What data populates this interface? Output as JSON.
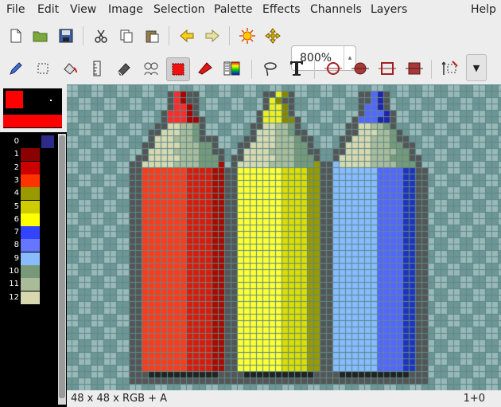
{
  "menus": [
    "File",
    "Edit",
    "View",
    "Image",
    "Selection",
    "Palette",
    "Effects",
    "Channels",
    "Layers",
    "Help"
  ],
  "toolbar1": [
    "new-icon",
    "open-icon",
    "save-icon",
    "cut-icon",
    "copy-icon",
    "paste-icon",
    "arrow-left-icon",
    "arrow-right-icon",
    "brightness-icon",
    "move-icon"
  ],
  "toolbar2": [
    "pencil-icon",
    "select-icon",
    "fill-icon",
    "ruler-icon",
    "eraser-icon",
    "clone-icon",
    "rect-tool-icon",
    "color-pick-icon",
    "gradient-icon",
    "lasso-icon",
    "text-icon",
    "circle-tool-icon",
    "ellipse-tool-icon",
    "square-tool-icon",
    "filled-square-icon",
    "flip-icon"
  ],
  "zoom": {
    "value": "800%"
  },
  "palette": {
    "entries": [
      {
        "index": "0",
        "color": "#000000",
        "alt": "#2c2c88"
      },
      {
        "index": "1",
        "color": "#8b0000"
      },
      {
        "index": "2",
        "color": "#cc0000"
      },
      {
        "index": "3",
        "color": "#ff3300"
      },
      {
        "index": "4",
        "color": "#999900"
      },
      {
        "index": "5",
        "color": "#cccc00"
      },
      {
        "index": "6",
        "color": "#ffff00"
      },
      {
        "index": "7",
        "color": "#3344ff"
      },
      {
        "index": "8",
        "color": "#6677ff"
      },
      {
        "index": "9",
        "color": "#88bbff"
      },
      {
        "index": "10",
        "color": "#779977"
      },
      {
        "index": "11",
        "color": "#aabb99"
      },
      {
        "index": "12",
        "color": "#d8d8b0"
      }
    ]
  },
  "colors": {
    "primary": "#ff0000",
    "secondary": "#000000",
    "grid": "#5a8a8a",
    "checker_light": "#9bb8b8",
    "checker_dark": "#6f9595"
  },
  "status": {
    "left": "48 x 48 x RGB + A",
    "right": "1+0"
  }
}
